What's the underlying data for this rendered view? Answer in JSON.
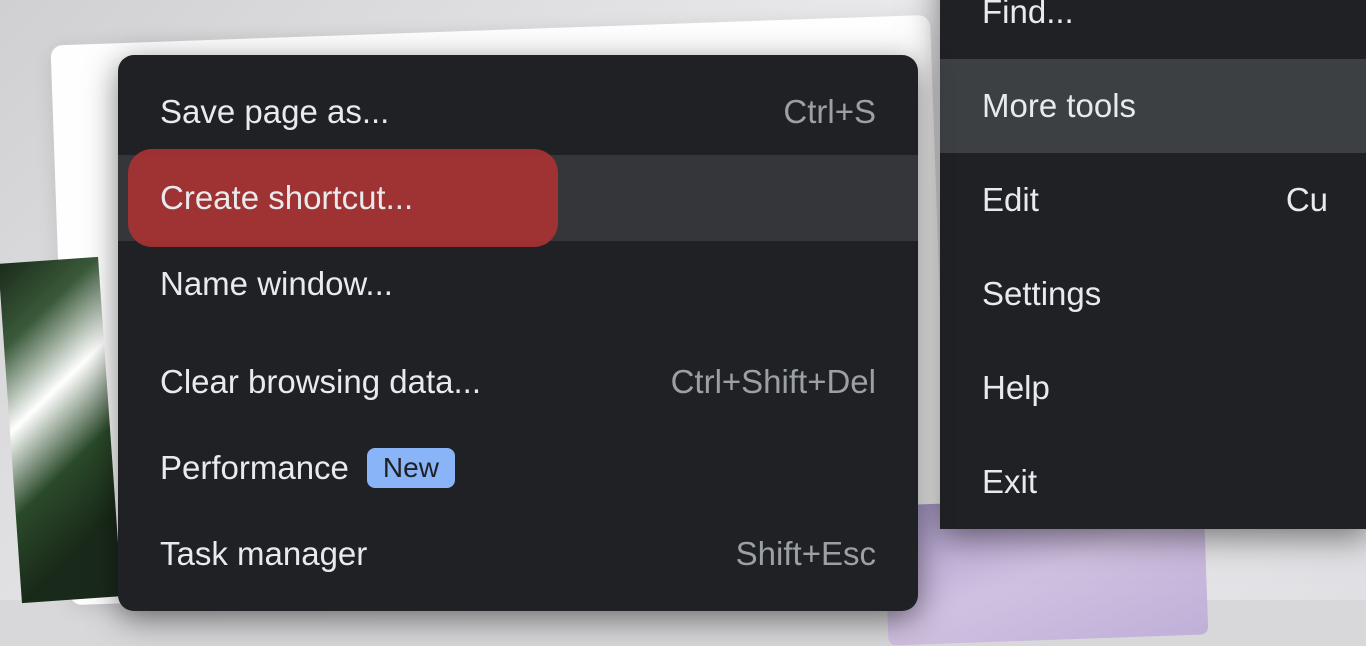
{
  "submenu": {
    "items": [
      {
        "label": "Save page as...",
        "shortcut": "Ctrl+S"
      },
      {
        "label": "Create shortcut...",
        "shortcut": ""
      },
      {
        "label": "Name window...",
        "shortcut": ""
      },
      {
        "label": "Clear browsing data...",
        "shortcut": "Ctrl+Shift+Del"
      },
      {
        "label": "Performance",
        "shortcut": "",
        "badge": "New"
      },
      {
        "label": "Task manager",
        "shortcut": "Shift+Esc"
      }
    ]
  },
  "main_menu": {
    "items": [
      {
        "label": "Find...",
        "shortcut": ""
      },
      {
        "label": "More tools",
        "shortcut": ""
      },
      {
        "label": "Edit",
        "shortcut": "Cu"
      },
      {
        "label": "Settings",
        "shortcut": ""
      },
      {
        "label": "Help",
        "shortcut": ""
      },
      {
        "label": "Exit",
        "shortcut": ""
      }
    ]
  }
}
